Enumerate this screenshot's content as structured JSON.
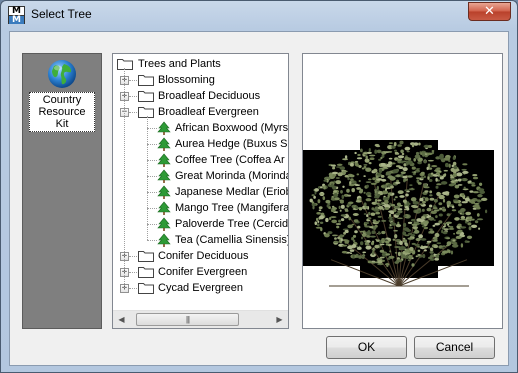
{
  "window": {
    "title": "Select Tree",
    "app_icon_top": "M",
    "app_icon_bottom": "M",
    "close_label": "✕"
  },
  "kit_panel": {
    "items": [
      {
        "label_line1": "Country",
        "label_line2": "Resource Kit",
        "icon": "globe-icon"
      }
    ]
  },
  "tree": {
    "root": "Trees and Plants",
    "categories": [
      {
        "label": "Blossoming",
        "expanded": false
      },
      {
        "label": "Broadleaf Deciduous",
        "expanded": false
      },
      {
        "label": "Broadleaf Evergreen",
        "expanded": true,
        "children": [
          "African Boxwood (Myrs",
          "Aurea Hedge (Buxus Se",
          "Coffee Tree (Coffea Ar",
          "Great Morinda (Morinda",
          "Japanese Medlar (Eriob",
          "Mango Tree (Mangifera",
          "Paloverde Tree (Cercid",
          "Tea (Camellia Sinensis)"
        ]
      },
      {
        "label": "Conifer Deciduous",
        "expanded": false
      },
      {
        "label": "Conifer Evergreen",
        "expanded": false
      },
      {
        "label": "Cycad Evergreen",
        "expanded": false
      }
    ],
    "expander_collapsed": "+",
    "expander_expanded": "−"
  },
  "scrollbar": {
    "left_arrow": "◀",
    "right_arrow": "▶",
    "thumb_grip": "|||"
  },
  "buttons": {
    "ok": "OK",
    "cancel": "Cancel"
  },
  "colors": {
    "tree_icon": "#2e9a36",
    "folder": "#ffffff",
    "foliage": "#5c6b45"
  }
}
